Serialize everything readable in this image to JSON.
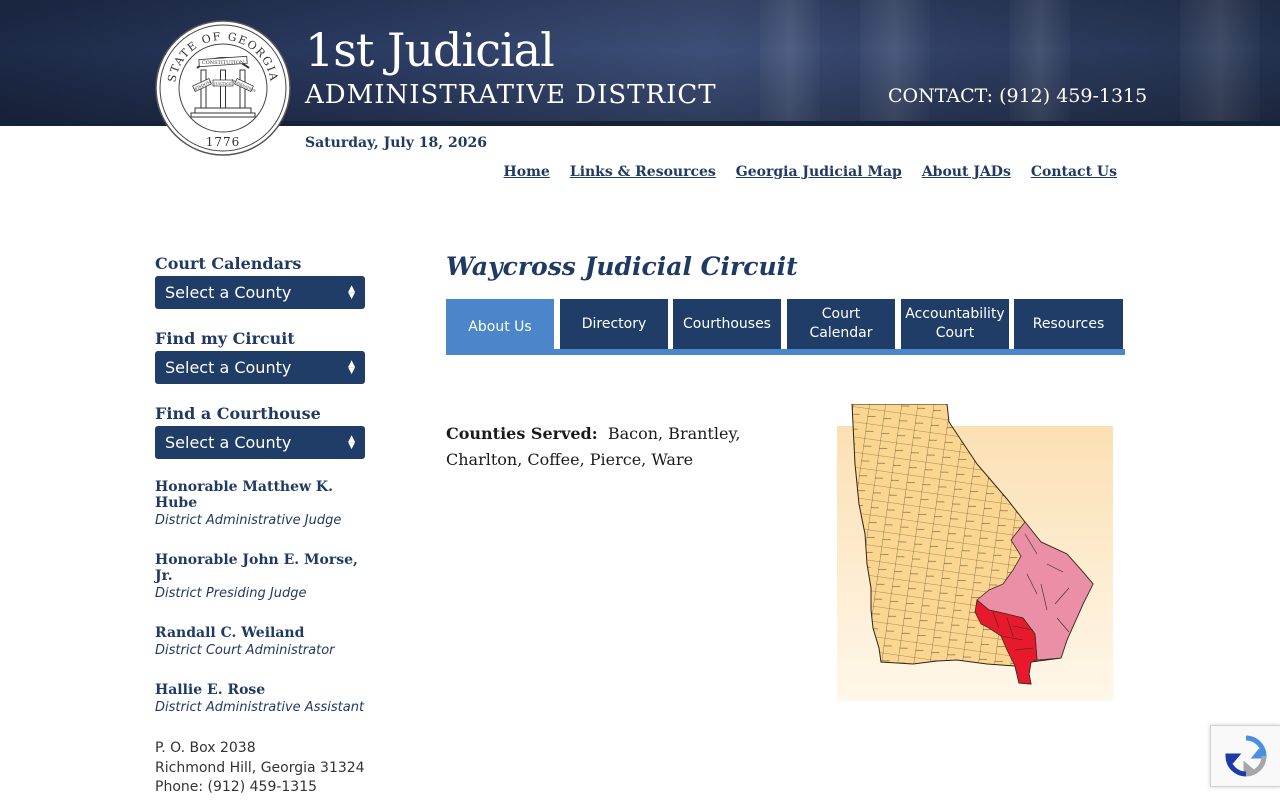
{
  "header": {
    "title_line1": "1st Judicial",
    "title_line2": "ADMINISTRATIVE DISTRICT",
    "contact": "CONTACT: (912) 459-1315",
    "seal_text": {
      "ring": "STATE OF GEORGIA",
      "banner": "CONSTITUTION",
      "left": "WISDOM",
      "center": "JUSTICE",
      "right": "MODERATION",
      "year": "1776"
    }
  },
  "date": "Saturday, July 18, 2026",
  "nav": {
    "home": "Home",
    "links": "Links & Resources",
    "map": "Georgia Judicial Map",
    "about": "About JADs",
    "contact": "Contact Us"
  },
  "sidebar": {
    "court_calendars": {
      "heading": "Court Calendars",
      "value": "Select a County"
    },
    "find_circuit": {
      "heading": "Find my Circuit",
      "value": "Select a County"
    },
    "find_courthouse": {
      "heading": "Find a Courthouse",
      "value": "Select a County"
    },
    "people": [
      {
        "name": "Honorable Matthew K. Hube",
        "role": "District Administrative Judge"
      },
      {
        "name": "Honorable John E. Morse, Jr.",
        "role": "District Presiding Judge"
      },
      {
        "name": "Randall C. Weiland",
        "role": "District Court Administrator"
      },
      {
        "name": "Hallie E. Rose",
        "role": "District Administrative Assistant"
      }
    ],
    "address": {
      "line1": "P. O. Box 2038",
      "line2": "Richmond Hill, Georgia 31324",
      "phone": "Phone: (912) 459-1315"
    }
  },
  "main": {
    "title": "Waycross Judicial Circuit",
    "tabs": {
      "about": "About Us",
      "directory": "Directory",
      "courthouses": "Courthouses",
      "calendar_1": "Court",
      "calendar_2": "Calendar",
      "accountability_1": "Accountability",
      "accountability_2": "Court",
      "resources": "Resources"
    },
    "counties_label": "Counties Served:",
    "counties_value": "Bacon, Brantley, Charlton, Coffee, Pierce, Ware"
  },
  "colors": {
    "navy": "#1f3d66",
    "tab_active": "#4a86c9",
    "map_base": "#fcd690",
    "district_pink": "#ea8fa5",
    "circuit_red": "#e8192c"
  }
}
